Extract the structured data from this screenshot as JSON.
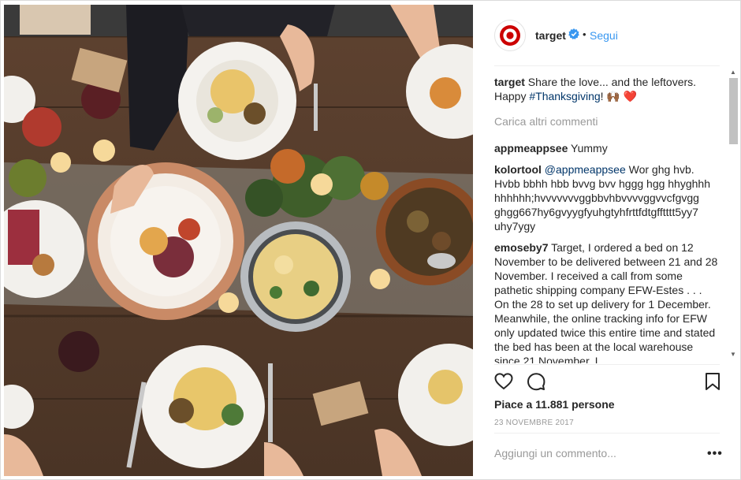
{
  "post": {
    "username": "target",
    "follow_label": "Segui",
    "separator": "•",
    "photo_alt": "Thanksgiving table seen from above"
  },
  "caption": {
    "user": "target",
    "text": "Share the love... and the leftovers. Happy ",
    "hashtag": "#Thanksgiving",
    "trail": "! 🙌🏾 ❤️"
  },
  "load_more_label": "Carica altri commenti",
  "comments": [
    {
      "user": "appmeappsee",
      "mention": "",
      "text": "Yummy"
    },
    {
      "user": "kolortool",
      "mention": "@appmeappsee",
      "text": "Wor ghg hvb. Hvbb bbhh hbb bvvg bvv hggg hgg hhyghhh hhhhhh;hvvvvvvvggbbvhbvvvvggvvcfgvgg ghgg667hy6gvyygfyuhgtyhfrttfdtgfftttt5yy7 uhy7ygy"
    },
    {
      "user": "emoseby7",
      "mention": "",
      "text": "Target, I ordered a bed on 12 November to be delivered between 21 and 28 November. I received a call from some pathetic shipping company EFW-Estes . . . On the 28 to set up delivery for 1 December. Meanwhile, the online tracking info for EFW only updated twice this entire time and stated the bed has been at the local warehouse since 21 November. I"
    }
  ],
  "likes_text": "Piace a 11.881 persone",
  "date_text": "23 NOVEMBRE 2017",
  "add_comment_placeholder": "Aggiungi un commento...",
  "more_options": "•••",
  "icons": {
    "verified": "verified-badge-icon",
    "like": "heart-outline-icon",
    "comment": "speech-bubble-icon",
    "save": "bookmark-icon",
    "avatar": "target-logo"
  },
  "colors": {
    "brand_red": "#cc0000",
    "link_blue": "#3897f0",
    "hashtag": "#003569",
    "muted": "#999999"
  }
}
